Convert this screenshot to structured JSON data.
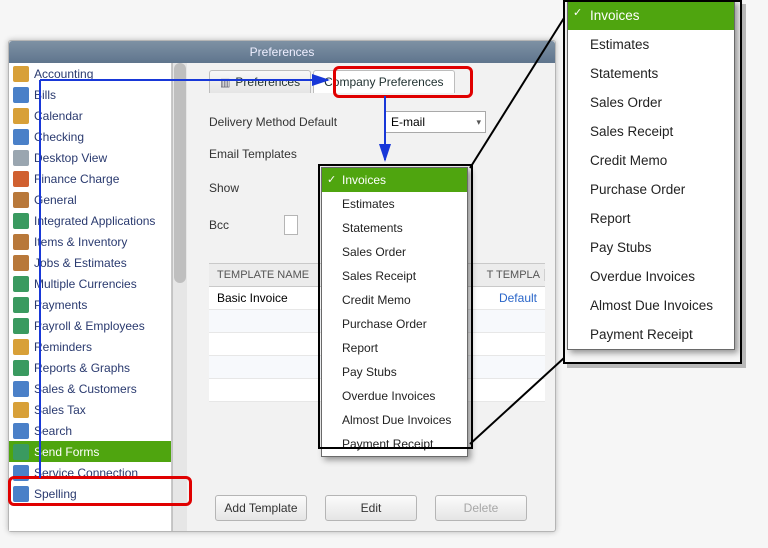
{
  "window": {
    "title": "Preferences"
  },
  "tabs": {
    "my": "Preferences",
    "company": "Company Preferences"
  },
  "sidebar": {
    "items": [
      {
        "label": "Accounting"
      },
      {
        "label": "Bills"
      },
      {
        "label": "Calendar"
      },
      {
        "label": "Checking"
      },
      {
        "label": "Desktop View"
      },
      {
        "label": "Finance Charge"
      },
      {
        "label": "General"
      },
      {
        "label": "Integrated Applications"
      },
      {
        "label": "Items & Inventory"
      },
      {
        "label": "Jobs & Estimates"
      },
      {
        "label": "Multiple Currencies"
      },
      {
        "label": "Payments"
      },
      {
        "label": "Payroll & Employees"
      },
      {
        "label": "Reminders"
      },
      {
        "label": "Reports & Graphs"
      },
      {
        "label": "Sales & Customers"
      },
      {
        "label": "Sales Tax"
      },
      {
        "label": "Search"
      },
      {
        "label": "Send Forms"
      },
      {
        "label": "Service Connection"
      },
      {
        "label": "Spelling"
      }
    ],
    "selected_index": 18
  },
  "panel": {
    "delivery_label": "Delivery Method Default",
    "delivery_value": "E-mail",
    "email_templates_label": "Email Templates",
    "show_label": "Show",
    "bcc_label": "Bcc",
    "table": {
      "col1": "TEMPLATE NAME",
      "col2": "TEMPLATE",
      "col2_suffix_caption": "T TEMPLA",
      "rows": [
        {
          "name": "Basic Invoice",
          "action": "Default"
        }
      ]
    },
    "buttons": {
      "add": "Add Template",
      "edit": "Edit",
      "delete": "Delete"
    },
    "stray_text": "Payment Receipt"
  },
  "menu_items": [
    "Invoices",
    "Estimates",
    "Statements",
    "Sales Order",
    "Sales Receipt",
    "Credit Memo",
    "Purchase Order",
    "Report",
    "Pay Stubs",
    "Overdue Invoices",
    "Almost Due Invoices",
    "Payment Receipt"
  ],
  "menu_selected_index": 0,
  "icons": {
    "colors": [
      "#d8a038",
      "#4a80c8",
      "#d8a038",
      "#4a80c8",
      "#9aa6b0",
      "#d06030",
      "#b8783a",
      "#3a9a60",
      "#b8783a",
      "#b8783a",
      "#3a9a60",
      "#3a9a60",
      "#3a9a60",
      "#d8a038",
      "#3a9a60",
      "#4a80c8",
      "#d8a038",
      "#4a80c8",
      "#3a9a60",
      "#4a80c8",
      "#4a80c8"
    ]
  }
}
